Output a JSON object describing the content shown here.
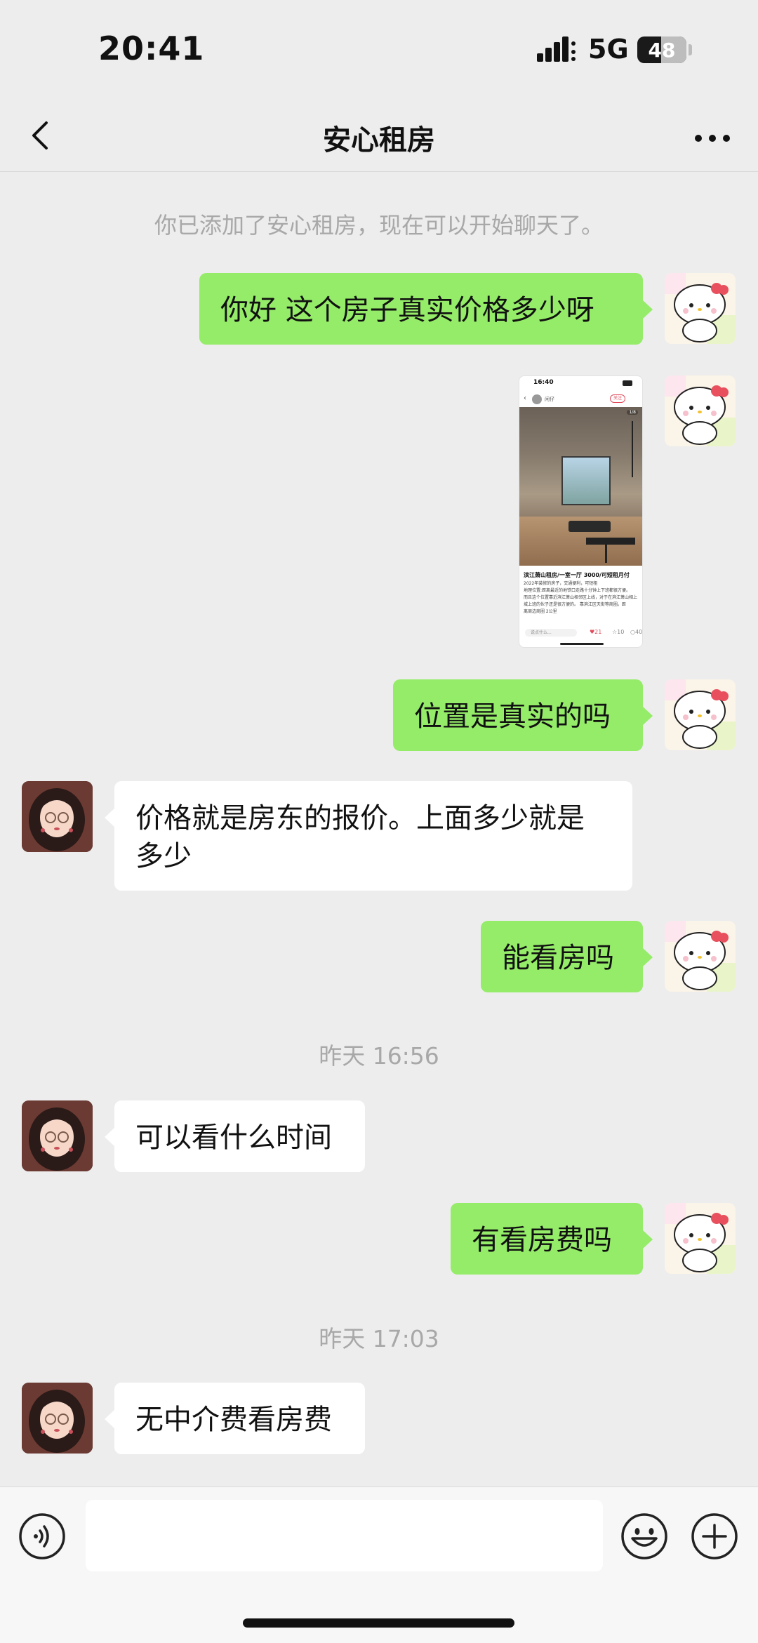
{
  "status_bar": {
    "time": "20:41",
    "network": "5G",
    "battery": "48"
  },
  "header": {
    "title": "安心租房"
  },
  "chat": {
    "system_message": "你已添加了安心租房，现在可以开始聊天了。",
    "messages": [
      {
        "from": "self",
        "text": "你好  这个房子真实价格多少呀"
      },
      {
        "from": "self",
        "type": "image"
      },
      {
        "from": "self",
        "text": "位置是真实的吗"
      },
      {
        "from": "other",
        "text": "价格就是房东的报价。上面多少就是多少"
      },
      {
        "from": "self",
        "text": "能看房吗"
      },
      {
        "from": "other",
        "text": "可以看什么时间"
      },
      {
        "from": "self",
        "text": "有看房费吗"
      },
      {
        "from": "other",
        "text": "无中介费看房费"
      }
    ],
    "timestamps": [
      "昨天 16:56",
      "昨天 17:03"
    ]
  },
  "shared_image": {
    "status_time": "16:40",
    "author": "闲仔",
    "follow": "关注",
    "page": "1/8",
    "title": "滨江萧山租房/一室一厅 3000/可短租月付",
    "body": [
      "2022年装修的房子，交通便利，可短租",
      "地理位置:距离最近的地铁口走路十分钟上下班都很方便。",
      "而且这个位置靠近滨江萧山相邻区上线，对于在滨江萧山相上",
      "城上班的伙子还是很方便的。 靠滨江区天街等商圈。距",
      "离周边商圈 2公里"
    ],
    "comment_placeholder": "说点什么...",
    "likes": "21",
    "stars": "10",
    "comments": "40"
  },
  "input_bar": {
    "placeholder": ""
  },
  "colors": {
    "self_bubble": "#95ec69",
    "other_bubble": "#ffffff",
    "background": "#ededed"
  }
}
